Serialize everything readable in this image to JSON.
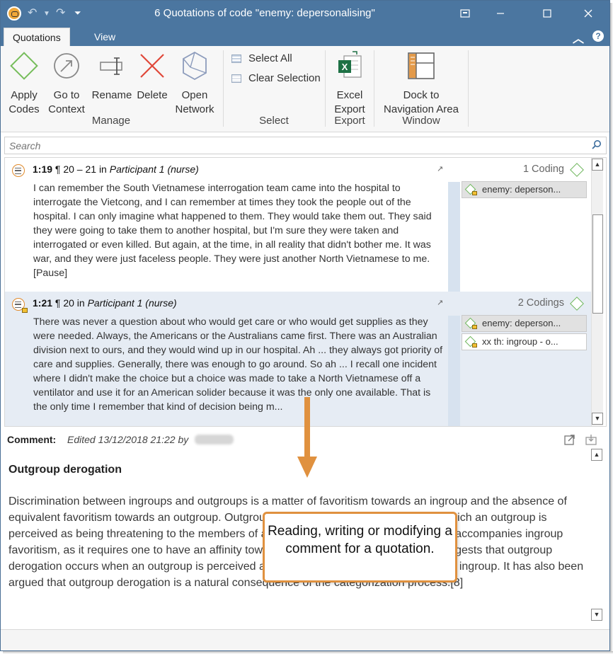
{
  "window": {
    "title": "6 Quotations of code \"enemy: depersonalising\""
  },
  "tabs": [
    {
      "label": "Quotations",
      "active": true
    },
    {
      "label": "View",
      "active": false
    }
  ],
  "ribbon": {
    "manage": {
      "label": "Manage",
      "apply_codes": [
        "Apply",
        "Codes"
      ],
      "go_to_context": [
        "Go to",
        "Context"
      ],
      "rename": "Rename",
      "delete": "Delete",
      "open_network": [
        "Open",
        "Network"
      ]
    },
    "select": {
      "label": "Select",
      "select_all": "Select All",
      "clear_selection": "Clear Selection"
    },
    "export": {
      "label": "Export",
      "excel_export": [
        "Excel",
        "Export"
      ]
    },
    "window": {
      "label": "Window",
      "dock": [
        "Dock to",
        "Navigation Area"
      ]
    }
  },
  "search": {
    "placeholder": "Search"
  },
  "quotations": [
    {
      "id": "1:19",
      "paragraphs": "¶ 20 – 21",
      "in": "in",
      "document": "Participant 1 (nurse)",
      "codings": "1 Coding",
      "codes": [
        "enemy: deperson..."
      ],
      "text": "I can remember the South Vietnamese interrogation team came into the hospital to interrogate the Vietcong, and I can remember at times they took the people out of the hospital. I can only imagine what happened to them. They would take them out. They said they were going to take them to another hospital, but I'm sure they were taken and interrogated or even killed. But again, at the time, in all reality that didn't bother me. It was war, and they were just faceless people. They were just another North Vietnamese to me. [Pause]"
    },
    {
      "id": "1:21",
      "paragraphs": "¶ 20",
      "in": "in",
      "document": "Participant 1 (nurse)",
      "codings": "2 Codings",
      "codes": [
        "enemy: deperson...",
        "xx th: ingroup - o..."
      ],
      "text": "There was never a question about who would get care or who would get supplies as they were needed. Always, the Americans or the Australians came first. There was an Australian division next to ours, and they would wind up in our hospital. Ah ... they always got priority of care and supplies. Generally, there was enough to go around. So ah ... I recall one incident where I didn't make the choice but a choice was made to take a North Vietnamese off a ventilator and use it for an American solider because it was the only one available. That is the only time I remember that kind of decision being m..."
    }
  ],
  "comment": {
    "label": "Comment:",
    "meta": "Edited 13/12/2018 21:22 by",
    "heading": "Outgroup derogation",
    "body": "Discrimination between ingroups and outgroups is a matter of favoritism towards an ingroup and the absence of equivalent favoritism towards an outgroup. Outgroup derogation is the phenomenon in which an outgroup is perceived as being threatening to the members of an ingroup.[7] This phenomenon often accompanies ingroup favoritism, as it requires one to have an affinity towards their ingroup. Some research suggests that outgroup derogation occurs when an outgroup is perceived as blocking or hindering the goals of an ingroup. It has also been argued that outgroup derogation is a natural consequence of the categorization process.[8]"
  },
  "callout": {
    "text": "Reading, writing or modifying a comment for a quotation."
  },
  "colors": {
    "title_bar": "#4b76a0",
    "accent_orange": "#e0913f",
    "code_green": "#6cb55a",
    "selection": "#e6ecf4"
  }
}
